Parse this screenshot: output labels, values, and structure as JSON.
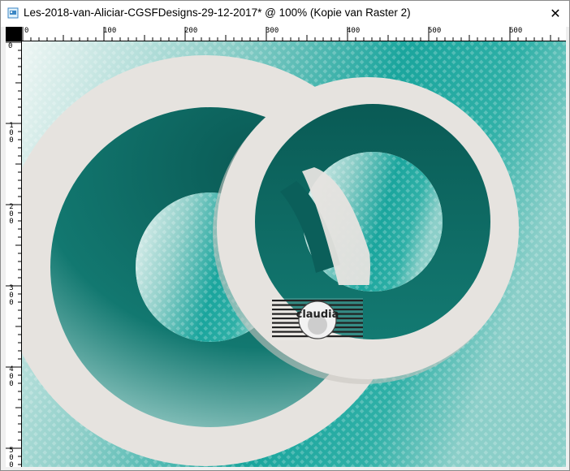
{
  "window": {
    "title": "Les-2018-van-Aliciar-CGSFDesigns-29-12-2017* @ 100% (Kopie van Raster 2)",
    "close_glyph": "✕",
    "icon": "image-document-icon"
  },
  "rulers": {
    "top_labels": [
      "0",
      "100",
      "200",
      "300",
      "400",
      "500",
      "600"
    ],
    "left_labels": [
      "0",
      "100",
      "200",
      "300",
      "400",
      "500"
    ]
  },
  "watermark": {
    "text": "claudia"
  },
  "colors": {
    "teal_dark": "#0b5f5a",
    "teal_mid": "#1e8f87",
    "teal_light": "#7fc6c1",
    "background_light": "#e6f1ef",
    "frame_beige": "#e6e3df"
  }
}
